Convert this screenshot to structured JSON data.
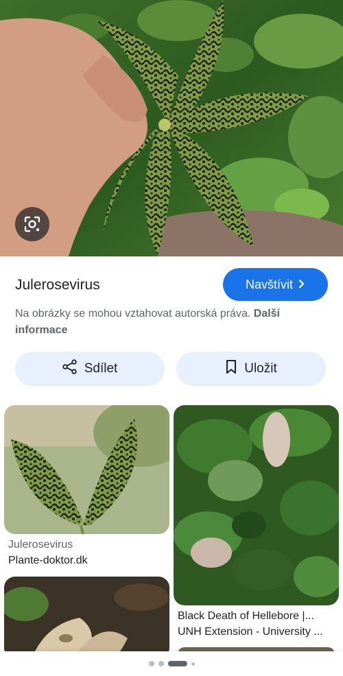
{
  "hero": {
    "lens_icon": "google-lens-icon"
  },
  "result": {
    "title": "Julerosevirus",
    "visit_label": "Navštívit",
    "visit_icon": "chevron-right-icon",
    "copyright_text": "Na obrázky se mohou vztahovat autorská práva.",
    "more_info_label": "Další informace"
  },
  "actions": {
    "share_label": "Sdílet",
    "share_icon": "share-icon",
    "save_label": "Uložit",
    "save_icon": "bookmark-icon"
  },
  "related": [
    {
      "title": "Julerosevirus",
      "source": "Plante-doktor.dk"
    },
    {
      "title": "Black Death of Hellebore |...",
      "source": "UNH Extension - University ..."
    }
  ],
  "colors": {
    "accent": "#1a73e8",
    "chip_bg": "#e8f0fe"
  }
}
